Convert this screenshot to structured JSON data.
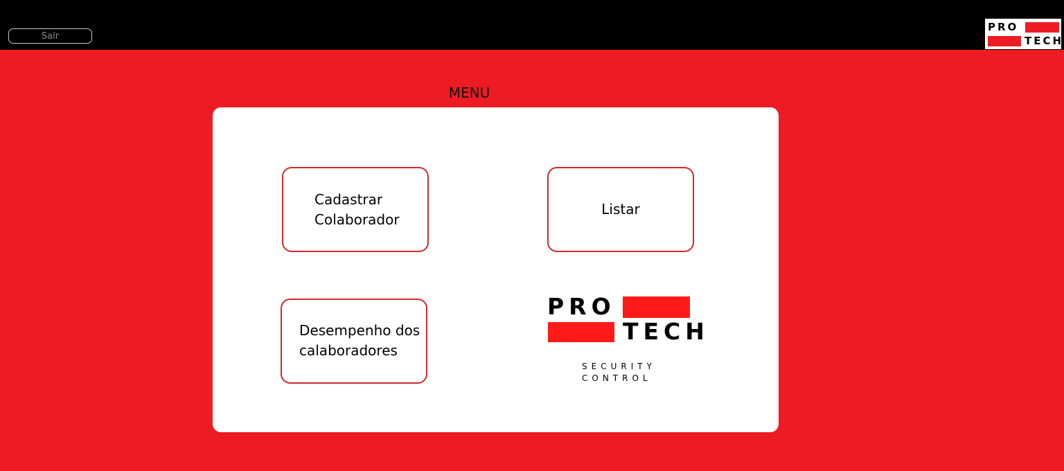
{
  "header": {
    "logout_label": "Sair",
    "logo": {
      "word_top": "PRO",
      "word_bottom": "TECH"
    }
  },
  "menu": {
    "title": "MENU",
    "buttons": [
      {
        "label": "Cadastrar\nColaborador"
      },
      {
        "label": "Listar"
      },
      {
        "label": "Desempenho dos\ncalaboradores"
      }
    ],
    "brand": {
      "word_top": "PRO",
      "word_bottom": "TECH",
      "tagline_line1": "SECURITY",
      "tagline_line2": "CONTROL"
    }
  },
  "colors": {
    "background": "#ED1C24",
    "topbar": "#000000",
    "panel": "#FFFFFF",
    "button_border": "#D7262E",
    "logo_accent": "#FF1A1A"
  }
}
